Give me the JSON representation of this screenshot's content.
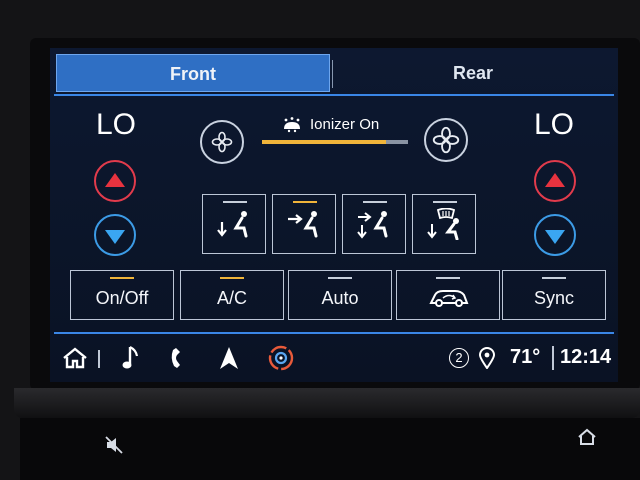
{
  "tabs": {
    "front": "Front",
    "rear": "Rear"
  },
  "climate": {
    "left_temp": "LO",
    "right_temp": "LO",
    "ionizer_label": "Ionizer On",
    "fan_level": 0.85,
    "accent": "#f0b43a"
  },
  "modes": [
    {
      "name": "floor",
      "icon": "airflow-floor-icon",
      "active": false
    },
    {
      "name": "face",
      "icon": "airflow-face-icon",
      "active": true
    },
    {
      "name": "face-floor",
      "icon": "airflow-face-floor-icon",
      "active": false
    },
    {
      "name": "defrost-floor",
      "icon": "airflow-defrost-floor-icon",
      "active": false
    }
  ],
  "functions": {
    "onoff": "On/Off",
    "ac": "A/C",
    "auto": "Auto",
    "recirc_icon": "recirculation-icon",
    "sync": "Sync"
  },
  "status": {
    "notification_count": "2",
    "temperature": "71°",
    "time": "12:14"
  },
  "colors": {
    "tab_active": "#2f6fc4",
    "up": "#e8333f",
    "down": "#3aa6f2"
  }
}
